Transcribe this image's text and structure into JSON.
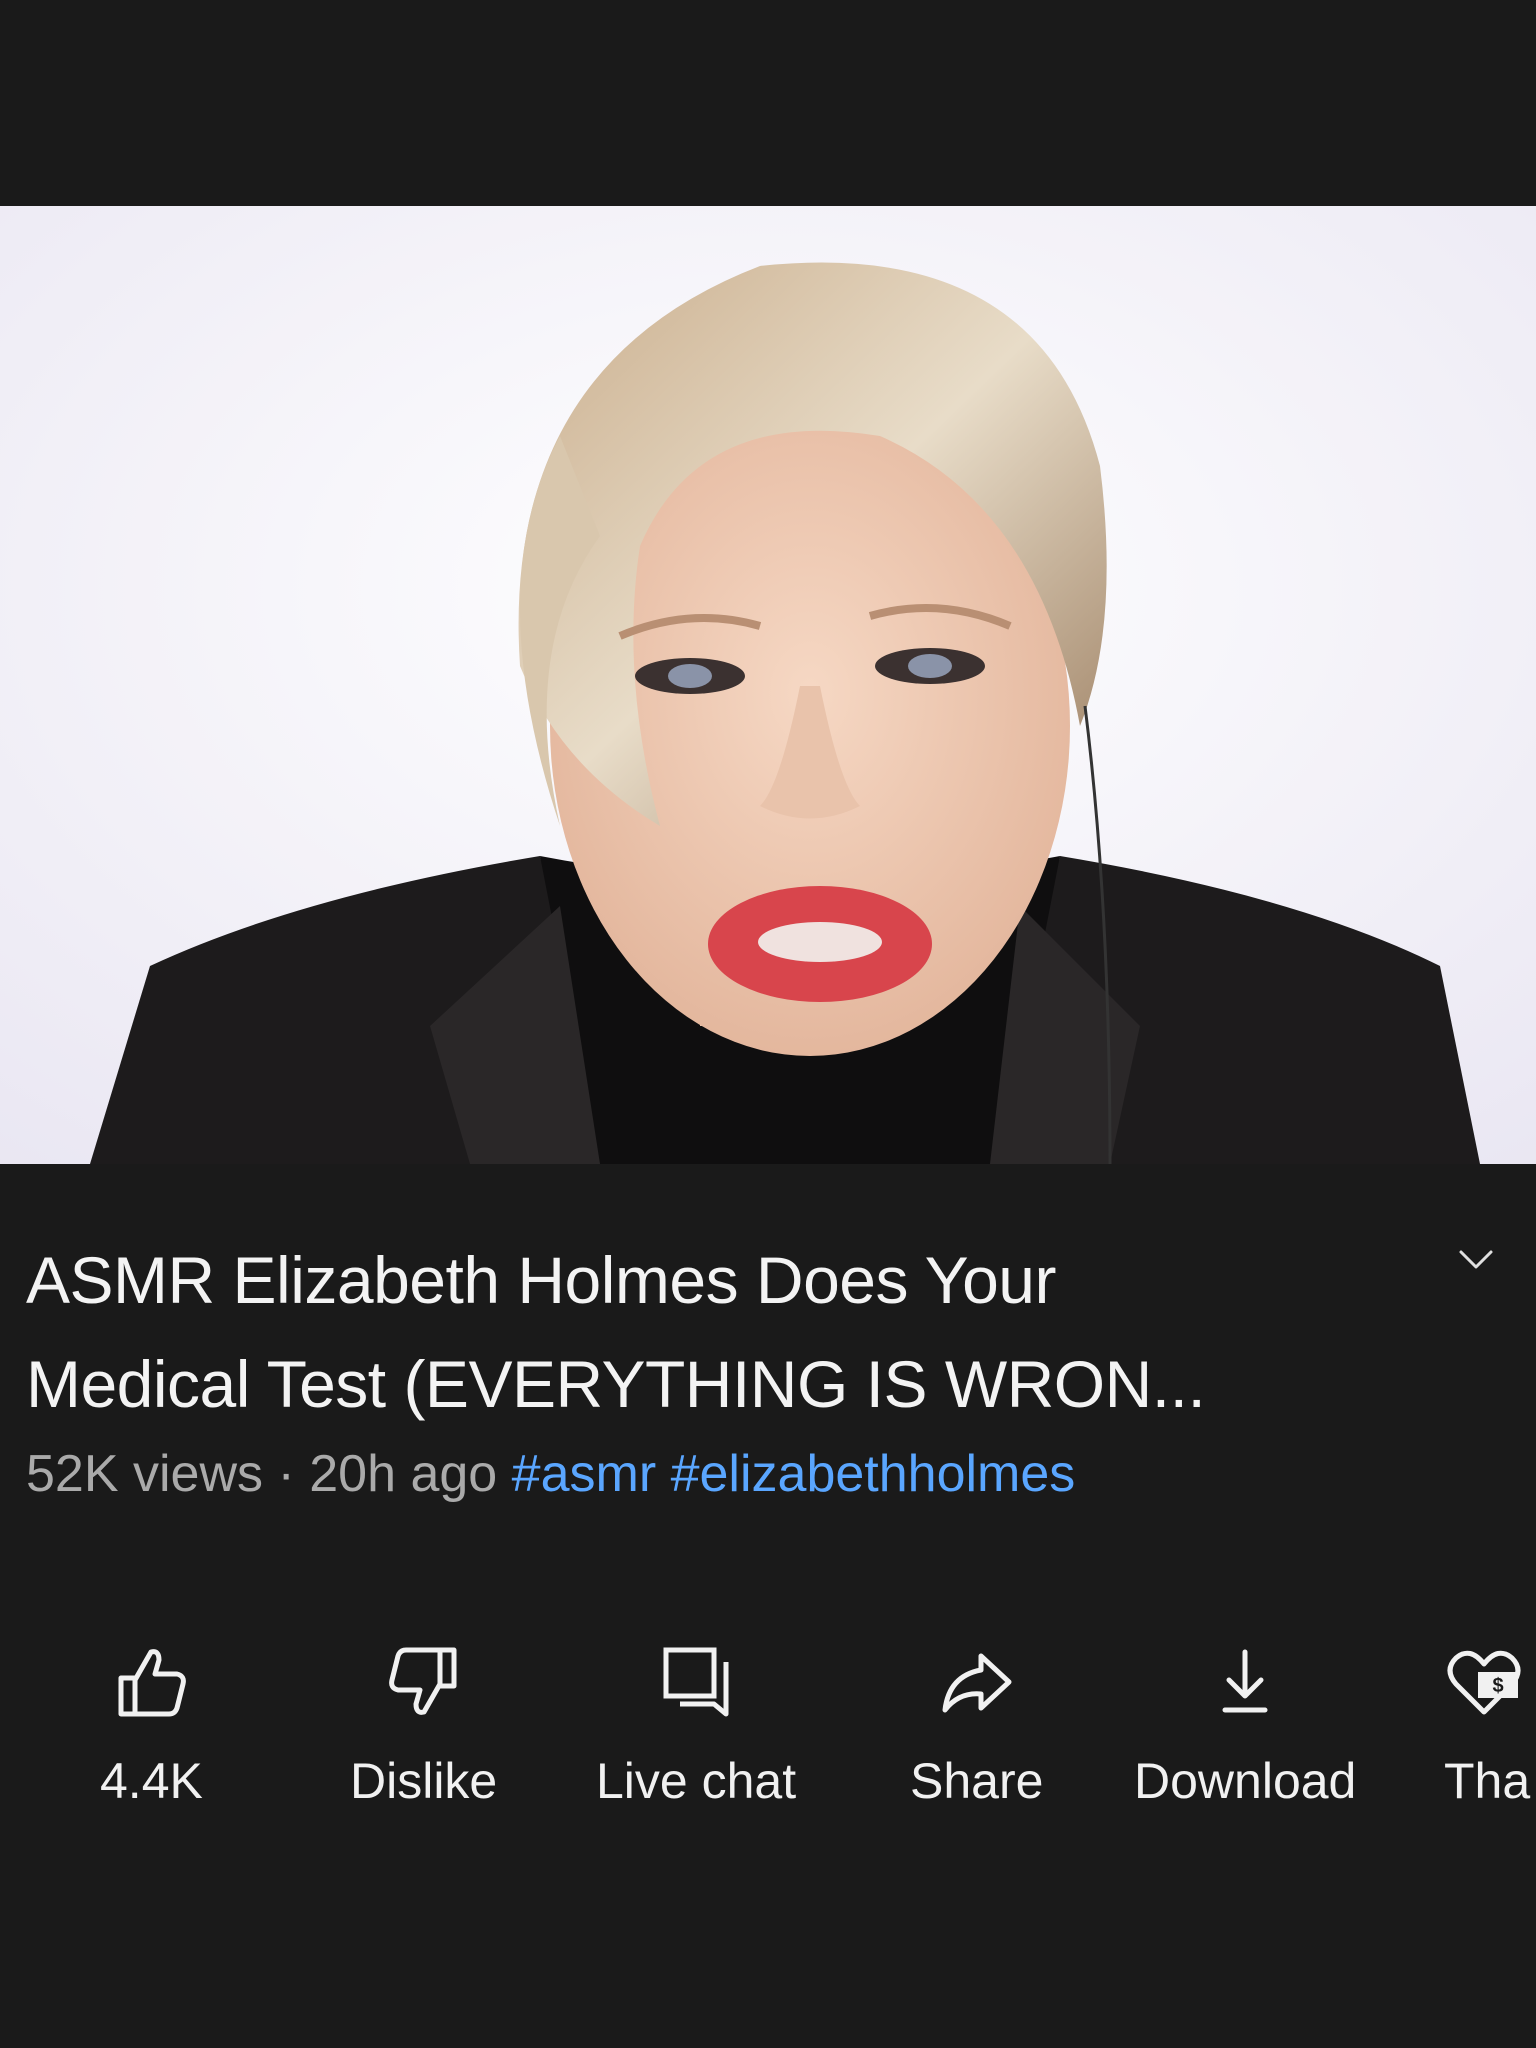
{
  "video": {
    "title_line1": "ASMR Elizabeth Holmes Does Your",
    "title_line2": "Medical Test (EVERYTHING IS WRON...",
    "views": "52K views",
    "separator": "·",
    "age": "20h ago",
    "hashtags": [
      "#asmr",
      "#elizabethholmes"
    ]
  },
  "actions": [
    {
      "label": "4.4K",
      "icon": "thumbs-up-icon"
    },
    {
      "label": "Dislike",
      "icon": "thumbs-down-icon"
    },
    {
      "label": "Live chat",
      "icon": "live-chat-icon"
    },
    {
      "label": "Share",
      "icon": "share-icon"
    },
    {
      "label": "Download",
      "icon": "download-icon"
    },
    {
      "label": "Tha",
      "icon": "thanks-icon"
    }
  ],
  "colors": {
    "background": "#1a1a1a",
    "hashtag": "#5aa6ff",
    "meta": "#aaaaaa",
    "text": "#f1f1f1"
  }
}
